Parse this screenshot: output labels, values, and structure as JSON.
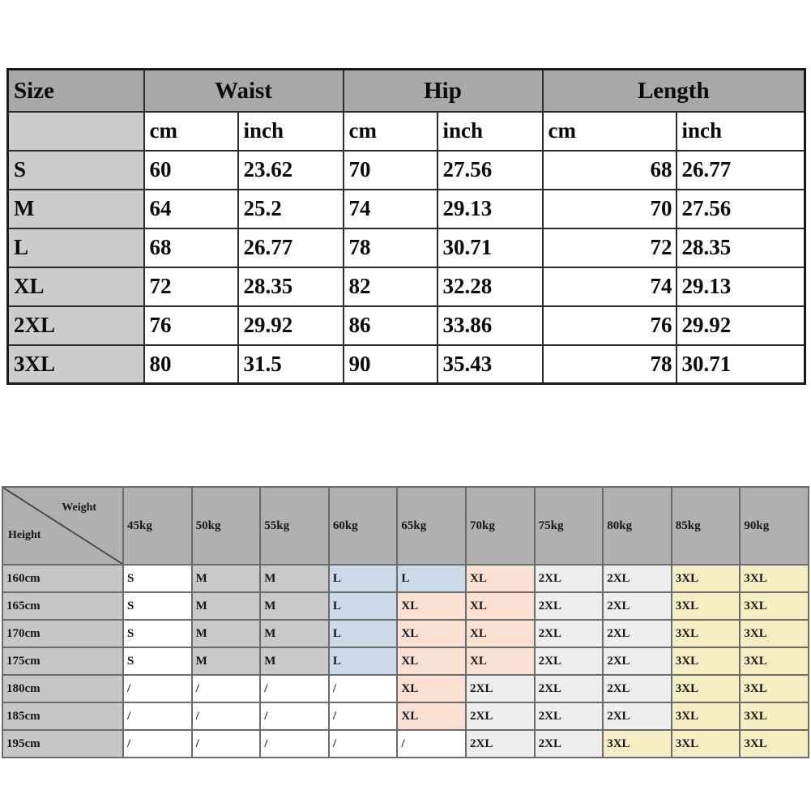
{
  "size_table": {
    "headers": {
      "size": "Size",
      "groups": [
        "Waist",
        "Hip",
        "Length"
      ],
      "units": [
        "cm",
        "inch",
        "cm",
        "inch",
        "cm",
        "inch"
      ]
    },
    "rows": [
      {
        "size": "S",
        "waist_cm": "60",
        "waist_inch": "23.62",
        "hip_cm": "70",
        "hip_inch": "27.56",
        "length_cm": "68",
        "length_inch": "26.77"
      },
      {
        "size": "M",
        "waist_cm": "64",
        "waist_inch": "25.2",
        "hip_cm": "74",
        "hip_inch": "29.13",
        "length_cm": "70",
        "length_inch": "27.56"
      },
      {
        "size": "L",
        "waist_cm": "68",
        "waist_inch": "26.77",
        "hip_cm": "78",
        "hip_inch": "30.71",
        "length_cm": "72",
        "length_inch": "28.35"
      },
      {
        "size": "XL",
        "waist_cm": "72",
        "waist_inch": "28.35",
        "hip_cm": "82",
        "hip_inch": "32.28",
        "length_cm": "74",
        "length_inch": "29.13"
      },
      {
        "size": "2XL",
        "waist_cm": "76",
        "waist_inch": "29.92",
        "hip_cm": "86",
        "hip_inch": "33.86",
        "length_cm": "76",
        "length_inch": "29.92"
      },
      {
        "size": "3XL",
        "waist_cm": "80",
        "waist_inch": "31.5",
        "hip_cm": "90",
        "hip_inch": "35.43",
        "length_cm": "78",
        "length_inch": "30.71"
      }
    ]
  },
  "fit_table": {
    "corner": {
      "weight_label": "Weight",
      "height_label": "Height"
    },
    "weights": [
      "45kg",
      "50kg",
      "55kg",
      "60kg",
      "65kg",
      "70kg",
      "75kg",
      "80kg",
      "85kg",
      "90kg"
    ],
    "heights": [
      "160cm",
      "165cm",
      "170cm",
      "175cm",
      "180cm",
      "185cm",
      "195cm"
    ],
    "matrix": [
      [
        "S",
        "M",
        "M",
        "L",
        "L",
        "XL",
        "2XL",
        "2XL",
        "3XL",
        "3XL"
      ],
      [
        "S",
        "M",
        "M",
        "L",
        "XL",
        "XL",
        "2XL",
        "2XL",
        "3XL",
        "3XL"
      ],
      [
        "S",
        "M",
        "M",
        "L",
        "XL",
        "XL",
        "2XL",
        "2XL",
        "3XL",
        "3XL"
      ],
      [
        "S",
        "M",
        "M",
        "L",
        "XL",
        "XL",
        "2XL",
        "2XL",
        "3XL",
        "3XL"
      ],
      [
        "/",
        "/",
        "/",
        "/",
        "XL",
        "2XL",
        "2XL",
        "2XL",
        "3XL",
        "3XL"
      ],
      [
        "/",
        "/",
        "/",
        "/",
        "XL",
        "2XL",
        "2XL",
        "2XL",
        "3XL",
        "3XL"
      ],
      [
        "/",
        "/",
        "/",
        "/",
        "/",
        "2XL",
        "2XL",
        "3XL",
        "3XL",
        "3XL"
      ]
    ]
  },
  "colors": {
    "header_gray": "#a8a8a8",
    "size_col_gray": "#cccccc",
    "fit_header_gray": "#b0b0b0",
    "fit_rowhdr_gray": "#c6c6c6",
    "S": "#ffffff",
    "M": "#c9c9c9",
    "L": "#ccd9e8",
    "XL": "#fae0d2",
    "2XL": "#eeeeee",
    "3XL": "#f7eec4",
    "NA": "#ffffff"
  }
}
